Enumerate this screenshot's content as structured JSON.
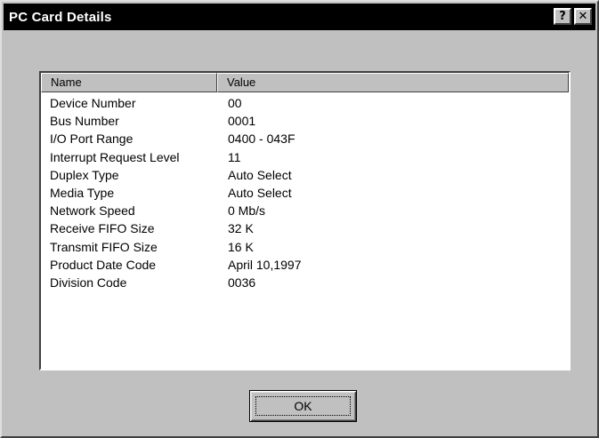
{
  "window": {
    "title": "PC Card Details",
    "help_label": "?",
    "close_label": "✕"
  },
  "list": {
    "columns": {
      "name": "Name",
      "value": "Value"
    },
    "rows": [
      {
        "name": "Device Number",
        "value": "00"
      },
      {
        "name": "Bus Number",
        "value": "0001"
      },
      {
        "name": "I/O Port Range",
        "value": "0400 - 043F"
      },
      {
        "name": "Interrupt Request Level",
        "value": "11"
      },
      {
        "name": "Duplex Type",
        "value": "Auto Select"
      },
      {
        "name": "Media Type",
        "value": "Auto Select"
      },
      {
        "name": "Network Speed",
        "value": "0 Mb/s"
      },
      {
        "name": "Receive FIFO Size",
        "value": "32 K"
      },
      {
        "name": "Transmit FIFO Size",
        "value": "16 K"
      },
      {
        "name": "Product Date Code",
        "value": "April 10,1997"
      },
      {
        "name": "Division Code",
        "value": "0036"
      }
    ]
  },
  "buttons": {
    "ok_label": "OK"
  }
}
